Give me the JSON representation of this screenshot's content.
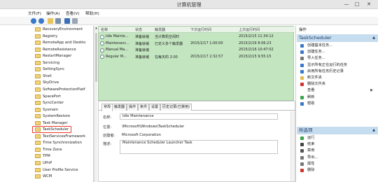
{
  "window": {
    "title": "计算机管理",
    "minimize": "—",
    "maximize": "□",
    "close": "✕"
  },
  "menu": [
    "文件(F)",
    "操作(A)",
    "查看(V)",
    "帮助(H)"
  ],
  "toolbar_icons": [
    "back-icon",
    "forward-icon",
    "folder-icon",
    "properties-icon",
    "help-icon",
    "panel-icon"
  ],
  "tree": [
    "RecoveryEnvironment",
    "Registry",
    "RemoteApp and Deskto",
    "RemoteAssistance",
    "RestartManager",
    "Servicing",
    "SettingSync",
    "Shell",
    "SkyDrive",
    "SoftwareProtectionPlatf",
    "SpacePort",
    "SyncCenter",
    "Sysmain",
    "SystemRestore",
    "Task Manager",
    "TaskScheduler",
    "TextServicesFramework",
    "Time Synchronization",
    "Time Zone",
    "TPM",
    "UPnP",
    "User Profile Service",
    "WCM"
  ],
  "tree_selected": "TaskScheduler",
  "tasks": {
    "columns": [
      "名称",
      "状态",
      "触发器",
      "下次运行时间",
      "上次运行时间"
    ],
    "rows": [
      [
        "Idle Mainte...",
        "准备就绪",
        "当计算机空闲时",
        "",
        "2015/2/15 11:34:12"
      ],
      [
        "Maintenanc...",
        "准备就绪",
        "已定义多个触发器",
        "2015/2/17 1:00:00",
        "2015/2/16 8:06:23"
      ],
      [
        "Manual Ma...",
        "准备就绪",
        "",
        "",
        "2015/2/16 10:47:02"
      ],
      [
        "Regular M...",
        "准备就绪",
        "在每天的 2:00",
        "2015/2/17 2:32:57",
        "2015/2/15 9:55:15"
      ]
    ]
  },
  "detail": {
    "tabs": [
      "常规",
      "触发器",
      "操作",
      "条件",
      "设置",
      "历史记录(已禁用)"
    ],
    "fields": [
      {
        "label": "名称:",
        "value": "Idle Maintenance"
      },
      {
        "label": "位置:",
        "value": "\\Microsoft\\Windows\\TaskScheduler"
      },
      {
        "label": "创建者:",
        "value": "Microsoft Corporation"
      },
      {
        "label": "描述:",
        "value": "Maintenance Scheduler Launcher Task"
      }
    ]
  },
  "actions": {
    "header": "操作",
    "section1": {
      "title": "TaskScheduler",
      "items": [
        {
          "label": "创建基本任务...",
          "icon": "create-basic-task-icon",
          "color": "#3a78c9"
        },
        {
          "label": "创建任务...",
          "icon": "create-task-icon",
          "color": "#3a78c9"
        },
        {
          "label": "导入任务...",
          "icon": "import-icon",
          "color": "#777777"
        },
        {
          "label": "显示所有正在运行的任务",
          "icon": "running-tasks-icon",
          "color": "#3a78c9"
        },
        {
          "label": "启用所有任务历史记录",
          "icon": "history-icon",
          "color": "#3a78c9"
        },
        {
          "label": "新文件夹",
          "icon": "new-folder-icon",
          "color": "#e8b84a"
        },
        {
          "label": "删除文件夹",
          "icon": "delete-folder-icon",
          "color": "#d0342c"
        },
        {
          "label": "查看",
          "icon": "view-icon",
          "color": "#ffffff",
          "submenu": "▶"
        },
        {
          "label": "刷新",
          "icon": "refresh-icon",
          "color": "#3aa34a"
        },
        {
          "label": "帮助",
          "icon": "help-icon",
          "color": "#3a78c9"
        }
      ]
    },
    "section2": {
      "title": "所选项",
      "items": [
        {
          "label": "运行",
          "icon": "run-icon",
          "color": "#3aa34a"
        },
        {
          "label": "结束",
          "icon": "stop-icon",
          "color": "#444444"
        },
        {
          "label": "禁用",
          "icon": "disable-icon",
          "color": "#555555"
        },
        {
          "label": "导出...",
          "icon": "export-icon",
          "color": "#777777"
        },
        {
          "label": "属性",
          "icon": "properties-icon",
          "color": "#777777"
        },
        {
          "label": "删除",
          "icon": "delete-icon",
          "color": "#d0342c"
        }
      ]
    }
  }
}
